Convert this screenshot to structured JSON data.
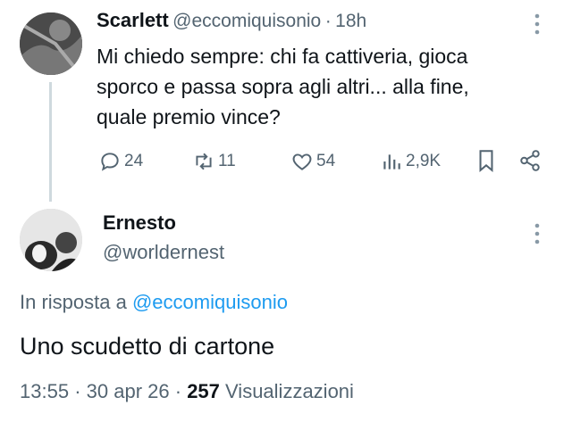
{
  "tweet": {
    "author_name": "Scarlett",
    "author_handle": "@eccomiquisonio",
    "separator": "·",
    "time": "18h",
    "text_lines": [
      "Mi chiedo sempre: chi fa cattiveria, gioca",
      "sporco e passa sopra agli altri... alla fine,",
      "quale premio vince?"
    ],
    "actions": {
      "replies": "24",
      "retweets": "11",
      "likes": "54",
      "views": "2,9K"
    }
  },
  "reply": {
    "author_name": "Ernesto",
    "author_handle": "@worldernest",
    "in_reply_prefix": "In risposta a",
    "in_reply_handle": "@eccomiquisonio",
    "text": "Uno scudetto di cartone",
    "time": "13:55",
    "sep1": "·",
    "date": "30 apr 26",
    "sep2": "·",
    "views_count": "257",
    "views_label": "Visualizzazioni"
  },
  "icons": [
    "more-icon",
    "reply-icon",
    "retweet-icon",
    "like-icon",
    "views-icon",
    "bookmark-icon",
    "share-icon"
  ],
  "colors": {
    "text": "#0f1419",
    "muted": "#536471",
    "link": "#1d9bf0",
    "thread_line": "#cfd9de"
  }
}
